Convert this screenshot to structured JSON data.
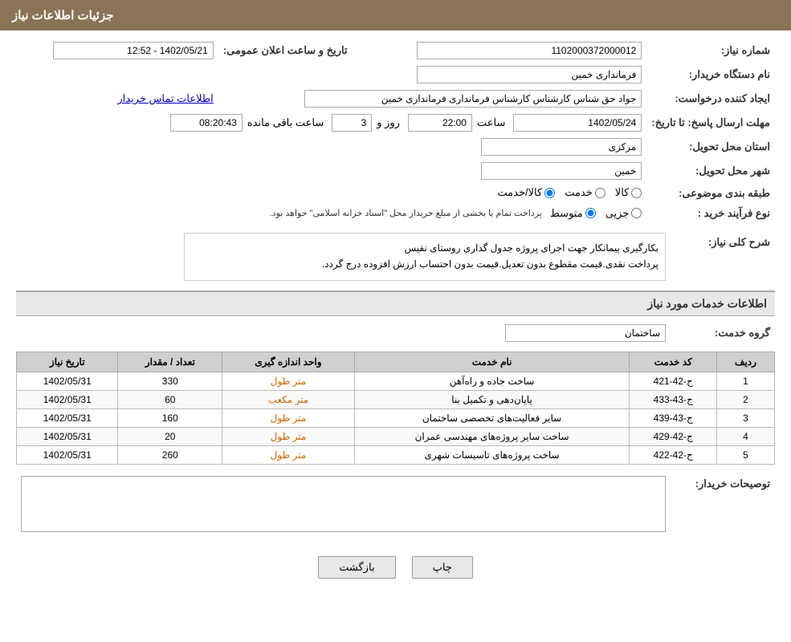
{
  "header": {
    "title": "جزئیات اطلاعات نیاز"
  },
  "fields": {
    "shomareNiaz_label": "شماره نیاز:",
    "shomareNiaz_value": "1102000372000012",
    "namdastgah_label": "نام دستگاه خریدار:",
    "namdastgah_value": "فرمانداری خمین",
    "ijadkonande_label": "ایجاد کننده درخواست:",
    "ijadkonande_value": "جواد حق شناس کارشناس کارشناس فرمانداری فرمانداری خمین",
    "contact_link": "اطلاعات تماس خریدار",
    "mohlatErsalPasokh_label": "مهلت ارسال پاسخ: تا تاریخ:",
    "date_value": "1402/05/24",
    "saat_label": "ساعت",
    "saat_value": "22:00",
    "roz_label": "روز و",
    "roz_value": "3",
    "baghimandeh_label": "ساعت باقی مانده",
    "baghimandeh_value": "08:20:43",
    "tarikh_elaan_label": "تاریخ و ساعت اعلان عمومی:",
    "tarikh_elaan_value": "1402/05/21 - 12:52",
    "ostan_label": "استان محل تحویل:",
    "ostan_value": "مرکزی",
    "shahr_label": "شهر محل تحویل:",
    "shahr_value": "خمین",
    "tabaqebandi_label": "طبقه بندی موضوعی:",
    "type_label": "نوع فرآیند خرید :",
    "kala_label": "کالا",
    "khedmat_label": "خدمت",
    "kala_khedmat_label": "کالا/خدمت",
    "jozvi_label": "جزیی",
    "motavasset_label": "متوسط",
    "type_note": "پرداخت تمام یا بخشی از مبلغ خریداز محل \"اسناد خزانه اسلامی\" خواهد بود.",
    "sharhKolli_label": "شرح کلی نیاز:",
    "sharhKolli_line1": "بکارگیری پیمانکار جهت اجرای پروژه جدول گذاری روستای نفیس",
    "sharhKolli_line2": "پرداخت نقدی.قیمت مقطوع بدون تعدیل.قیمت بدون احتساب ارزش افزوده درج گردد.",
    "etelaat_label": "اطلاعات خدمات مورد نیاز",
    "groheKhedmat_label": "گروه خدمت:",
    "groheKhedmat_value": "ساختمان",
    "table": {
      "headers": [
        "ردیف",
        "کد خدمت",
        "نام خدمت",
        "واحد اندازه گیری",
        "تعداد / مقدار",
        "تاریخ نیاز"
      ],
      "rows": [
        {
          "radif": "1",
          "kod": "ج-42-421",
          "name": "ساخت جاده و راه‌آهن",
          "vahed": "متر طول",
          "tedad": "330",
          "tarikh": "1402/05/31"
        },
        {
          "radif": "2",
          "kod": "ج-43-433",
          "name": "پایان‌دهی و تکمیل بنا",
          "vahed": "متر مکعب",
          "tedad": "60",
          "tarikh": "1402/05/31"
        },
        {
          "radif": "3",
          "kod": "ج-43-439",
          "name": "سایر فعالیت‌های تخصصی ساختمان",
          "vahed": "متر طول",
          "tedad": "160",
          "tarikh": "1402/05/31"
        },
        {
          "radif": "4",
          "kod": "ج-42-429",
          "name": "ساخت سایر پروژه‌های مهندسی عمران",
          "vahed": "متر طول",
          "tedad": "20",
          "tarikh": "1402/05/31"
        },
        {
          "radif": "5",
          "kod": "ج-42-422",
          "name": "ساخت پروژه‌های تاسیسات شهری",
          "vahed": "متر طول",
          "tedad": "260",
          "tarikh": "1402/05/31"
        }
      ]
    },
    "tosihKharidar_label": "توصیحات خریدار:",
    "btn_bazgasht": "بازگشت",
    "btn_chap": "چاپ"
  }
}
